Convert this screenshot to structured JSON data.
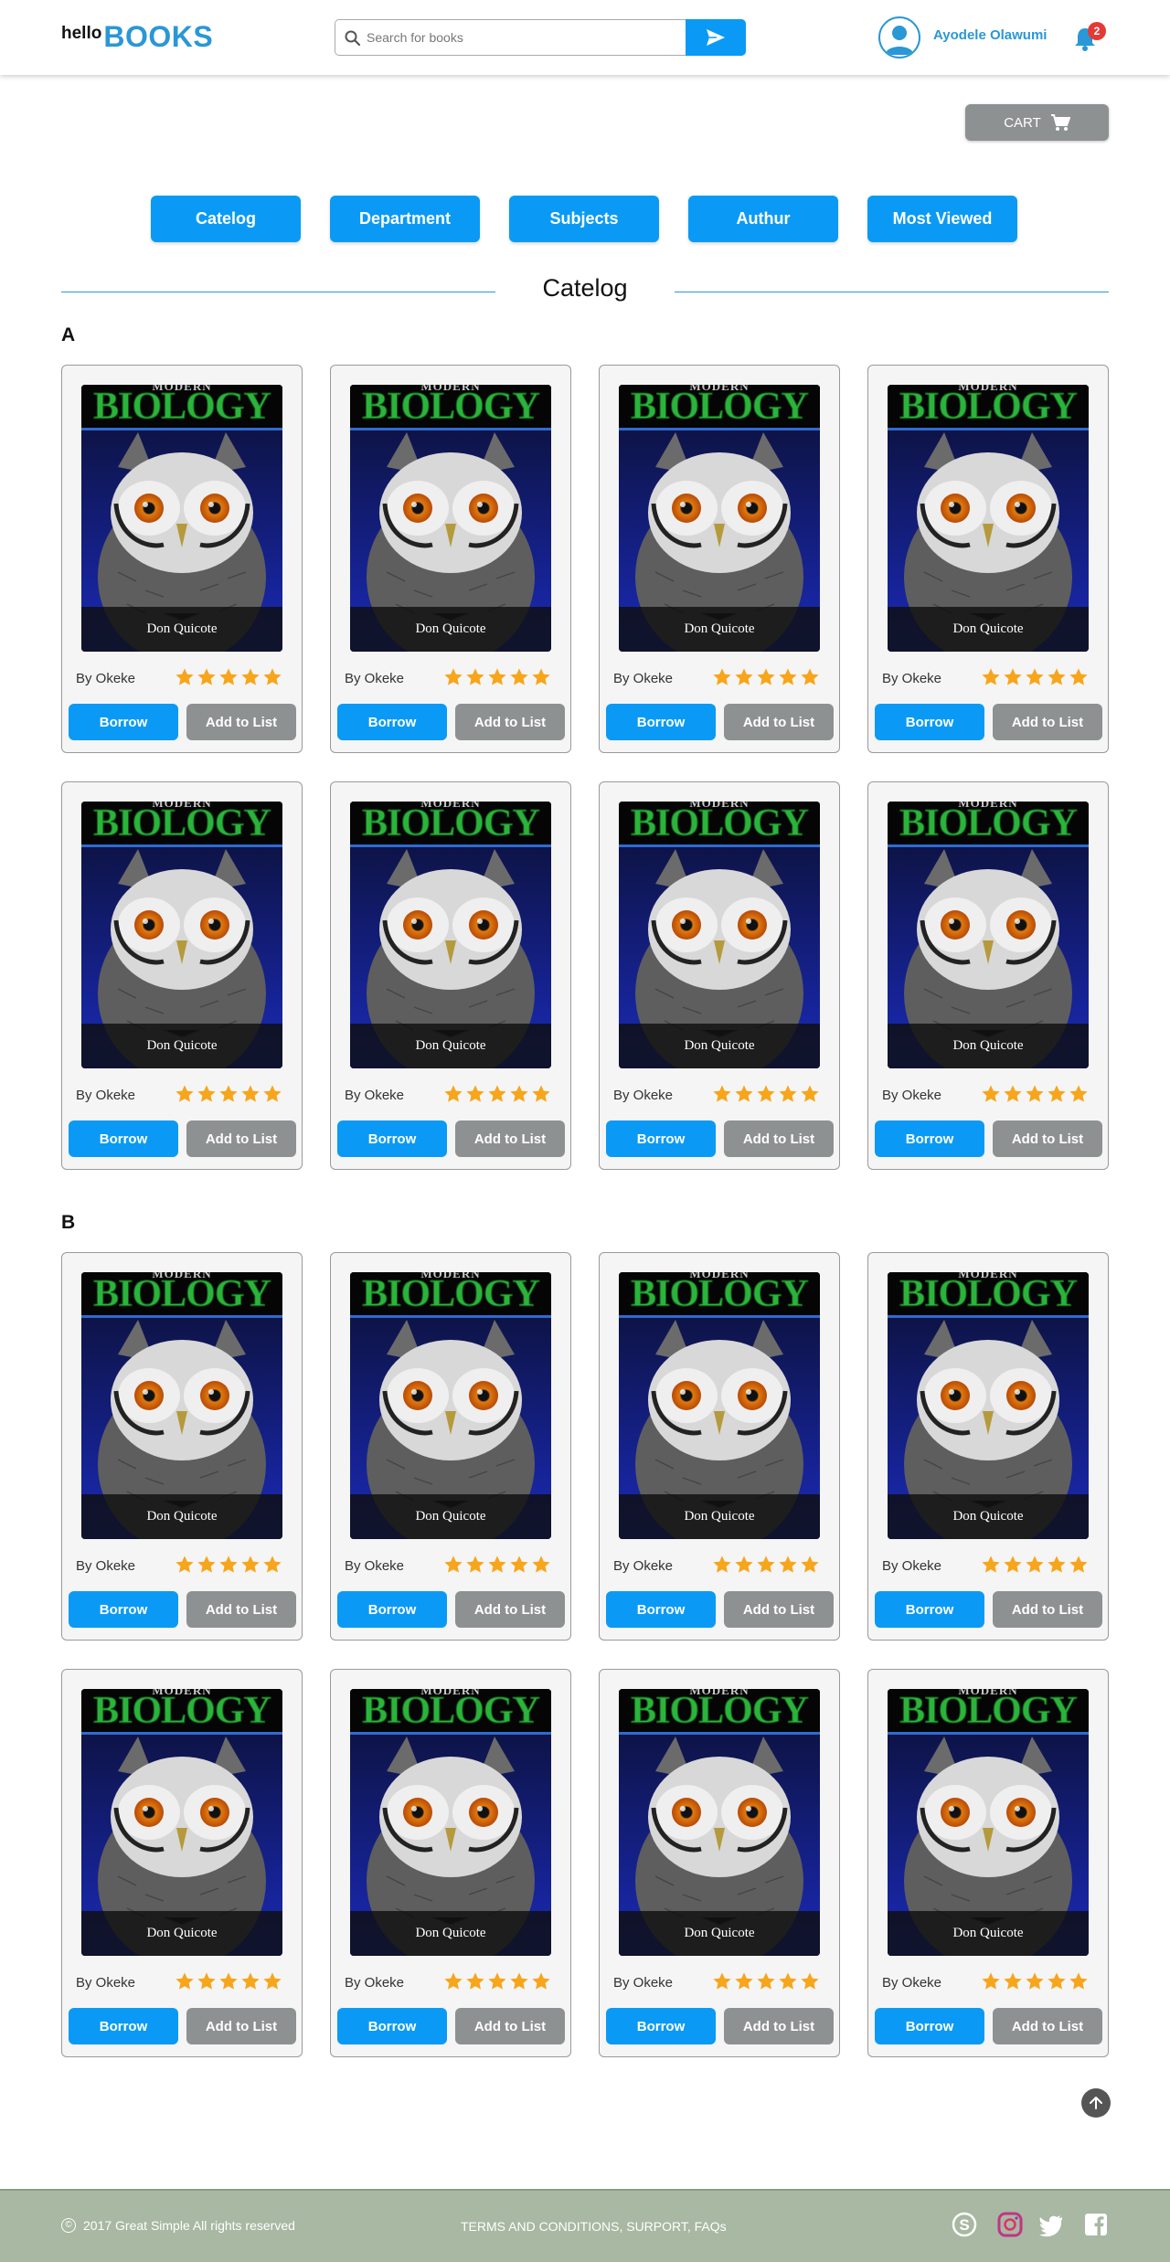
{
  "header": {
    "logo_small": "hello",
    "logo_big": "BOOKS",
    "search_placeholder": "Search for books",
    "user_name": "Ayodele Olawumi",
    "notification_count": "2"
  },
  "cart": {
    "label": "CART"
  },
  "nav": [
    "Catelog",
    "Department",
    "Subjects",
    "Authur",
    "Most Viewed"
  ],
  "section_title": "Catelog",
  "groups": [
    {
      "letter": "A",
      "books": [
        {
          "cover_series": "MODERN",
          "cover_subject": "BIOLOGY",
          "title": "Don Quicote",
          "author": "By Okeke",
          "rating": 5
        },
        {
          "cover_series": "MODERN",
          "cover_subject": "BIOLOGY",
          "title": "Don Quicote",
          "author": "By Okeke",
          "rating": 5
        },
        {
          "cover_series": "MODERN",
          "cover_subject": "BIOLOGY",
          "title": "Don Quicote",
          "author": "By Okeke",
          "rating": 5
        },
        {
          "cover_series": "MODERN",
          "cover_subject": "BIOLOGY",
          "title": "Don Quicote",
          "author": "By Okeke",
          "rating": 5
        },
        {
          "cover_series": "MODERN",
          "cover_subject": "BIOLOGY",
          "title": "Don Quicote",
          "author": "By Okeke",
          "rating": 5
        },
        {
          "cover_series": "MODERN",
          "cover_subject": "BIOLOGY",
          "title": "Don Quicote",
          "author": "By Okeke",
          "rating": 5
        },
        {
          "cover_series": "MODERN",
          "cover_subject": "BIOLOGY",
          "title": "Don Quicote",
          "author": "By Okeke",
          "rating": 5
        },
        {
          "cover_series": "MODERN",
          "cover_subject": "BIOLOGY",
          "title": "Don Quicote",
          "author": "By Okeke",
          "rating": 5
        }
      ]
    },
    {
      "letter": "B",
      "books": [
        {
          "cover_series": "MODERN",
          "cover_subject": "BIOLOGY",
          "title": "Don Quicote",
          "author": "By Okeke",
          "rating": 5
        },
        {
          "cover_series": "MODERN",
          "cover_subject": "BIOLOGY",
          "title": "Don Quicote",
          "author": "By Okeke",
          "rating": 5
        },
        {
          "cover_series": "MODERN",
          "cover_subject": "BIOLOGY",
          "title": "Don Quicote",
          "author": "By Okeke",
          "rating": 5
        },
        {
          "cover_series": "MODERN",
          "cover_subject": "BIOLOGY",
          "title": "Don Quicote",
          "author": "By Okeke",
          "rating": 5
        },
        {
          "cover_series": "MODERN",
          "cover_subject": "BIOLOGY",
          "title": "Don Quicote",
          "author": "By Okeke",
          "rating": 5
        },
        {
          "cover_series": "MODERN",
          "cover_subject": "BIOLOGY",
          "title": "Don Quicote",
          "author": "By Okeke",
          "rating": 5
        },
        {
          "cover_series": "MODERN",
          "cover_subject": "BIOLOGY",
          "title": "Don Quicote",
          "author": "By Okeke",
          "rating": 5
        },
        {
          "cover_series": "MODERN",
          "cover_subject": "BIOLOGY",
          "title": "Don Quicote",
          "author": "By Okeke",
          "rating": 5
        }
      ]
    }
  ],
  "actions": {
    "borrow": "Borrow",
    "add_to_list": "Add to List"
  },
  "footer": {
    "copyright": "2017 Great Simple All rights reserved",
    "links": "TERMS AND CONDITIONS, SURPORT,  FAQs",
    "social_icons": [
      "skype-icon",
      "instagram-icon",
      "twitter-icon",
      "facebook-icon"
    ]
  },
  "colors": {
    "primary": "#0a9af5",
    "brand": "#2a97d6",
    "secondary": "#8e9192",
    "star": "#f7a51b",
    "footer": "#a8b8a2"
  }
}
